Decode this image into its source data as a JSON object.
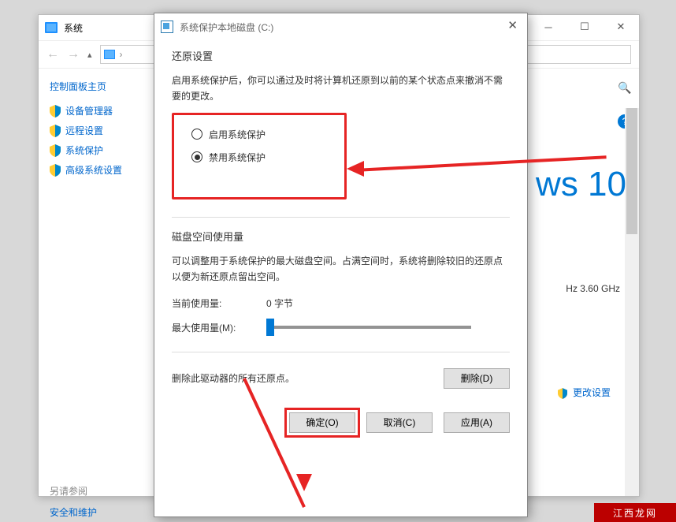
{
  "bg_window": {
    "title": "系统",
    "search_placeholder": "搜",
    "sidebar": {
      "home": "控制面板主页",
      "items": [
        "设备管理器",
        "远程设置",
        "系统保护",
        "高级系统设置"
      ],
      "refer": "另请参阅",
      "safety": "安全和维护"
    },
    "win_logo": "ws 10",
    "cpu": "Hz   3.60 GHz",
    "change_link": "更改设置"
  },
  "dialog": {
    "title": "系统保护本地磁盘 (C:)",
    "restore_section": "还原设置",
    "restore_desc": "启用系统保护后，你可以通过及时将计算机还原到以前的某个状态点来撤消不需要的更改。",
    "opt_enable": "启用系统保护",
    "opt_disable": "禁用系统保护",
    "disk_section": "磁盘空间使用量",
    "disk_desc": "可以调整用于系统保护的最大磁盘空间。占满空间时，系统将删除较旧的还原点以便为新还原点留出空间。",
    "current_usage_label": "当前使用量:",
    "current_usage_value": "0 字节",
    "max_usage_label": "最大使用量(M):",
    "delete_desc": "删除此驱动器的所有还原点。",
    "delete_btn": "删除(D)",
    "ok_btn": "确定(O)",
    "cancel_btn": "取消(C)",
    "apply_btn": "应用(A)"
  },
  "watermark": "江西龙网"
}
